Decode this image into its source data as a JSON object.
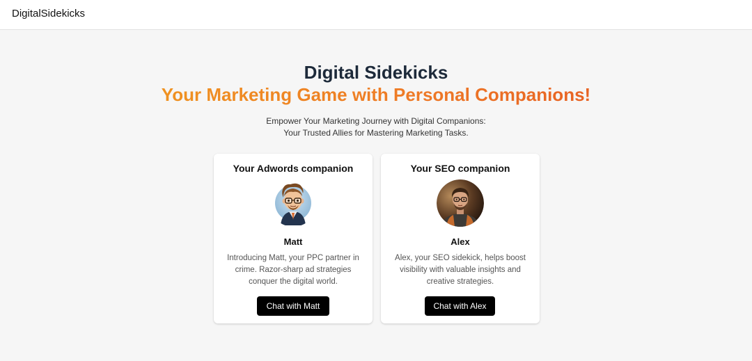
{
  "nav": {
    "brand": "DigitalSidekicks"
  },
  "hero": {
    "title": "Digital Sidekicks",
    "subtitle": "Your Marketing Game with Personal Companions!",
    "desc_line1": "Empower Your Marketing Journey with Digital Companions:",
    "desc_line2": "Your Trusted Allies for Mastering Marketing Tasks."
  },
  "cards": [
    {
      "title": "Your Adwords companion",
      "name": "Matt",
      "bio": "Introducing Matt, your PPC partner in crime. Razor-sharp ad strategies conquer the digital world.",
      "button": "Chat with Matt"
    },
    {
      "title": "Your SEO companion",
      "name": "Alex",
      "bio": "Alex, your SEO sidekick, helps boost visibility with valuable insights and creative strategies.",
      "button": "Chat with Alex"
    }
  ],
  "colors": {
    "accent_start": "#f0a11d",
    "accent_end": "#e24e22",
    "title": "#1d2a3a",
    "button_bg": "#000000"
  }
}
